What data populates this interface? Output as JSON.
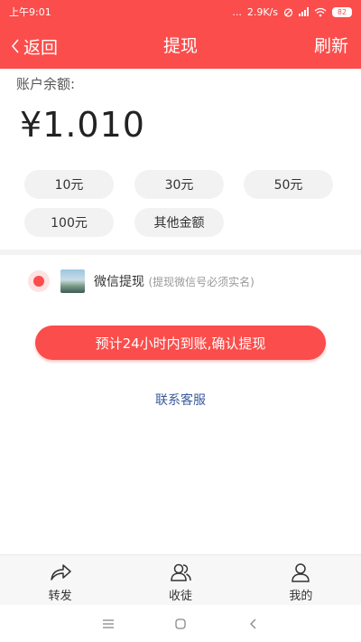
{
  "status_bar": {
    "time": "上午9:01",
    "dots": "...",
    "speed": "2.9K/s",
    "battery": "82"
  },
  "nav": {
    "back_label": "返回",
    "title": "提现",
    "refresh_label": "刷新"
  },
  "balance": {
    "label": "账户余额:",
    "amount": "¥1.010"
  },
  "amount_options": [
    "10元",
    "30元",
    "50元",
    "100元",
    "其他金额"
  ],
  "payment": {
    "name": "微信提现",
    "note": "(提现微信号必须实名)",
    "selected": true
  },
  "confirm_label": "预计24小时内到账,确认提现",
  "service_link": "联系客服",
  "tabs": [
    {
      "label": "转发",
      "icon": "share-icon"
    },
    {
      "label": "收徒",
      "icon": "users-icon"
    },
    {
      "label": "我的",
      "icon": "person-icon"
    }
  ],
  "system_nav": [
    "menu-icon",
    "home-icon",
    "back-icon"
  ],
  "colors": {
    "accent": "#fb4d4b",
    "link": "#3a5a9a",
    "chip_bg": "#f2f2f2"
  }
}
